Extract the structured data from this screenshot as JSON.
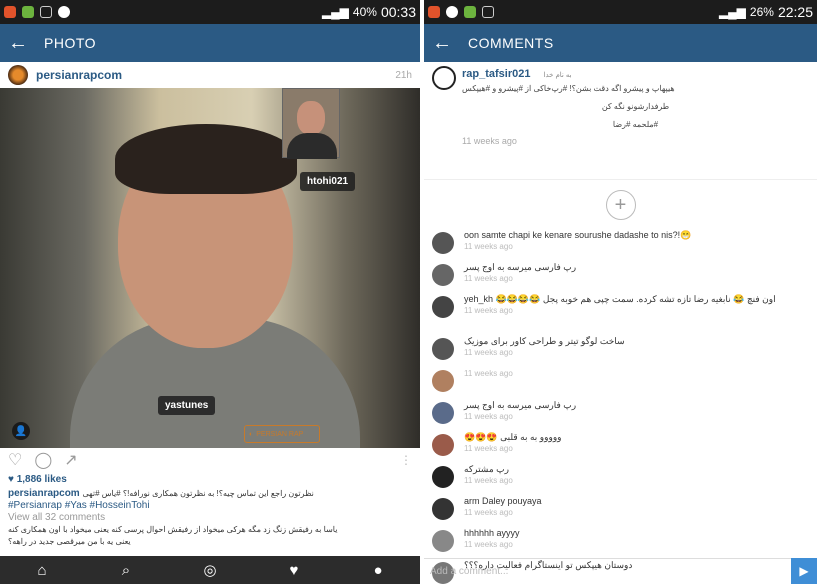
{
  "left": {
    "status": {
      "battery": "40%",
      "time": "00:33"
    },
    "appbar": {
      "title": "PHOTO"
    },
    "post": {
      "username": "persianrapcom",
      "time_ago": "21h",
      "tag_1": "htohi021",
      "tag_2": "yastunes",
      "logo_text": "PERSIAN RAP",
      "likes": "1,886 likes",
      "caption_user": "persianrapcom",
      "caption_text": "نظرتون راجع این تماس چیه؟! به نظرتون همکاری نورافه!؟ #یاس #تهی",
      "hashtags": "#Persianrap #Yas #HosseinTohi",
      "view_all": "View all 32 comments",
      "comment_1": "یاسا به رفیقش زنگ زد مگه هرکی میخواد از رفیقش احوال پرسی کنه یعنی میخواد با اون همکاری کنه",
      "comment_2": "یعنی یه با من میرقصی جدید در راهه؟"
    },
    "nav": [
      "⌂",
      "⌕",
      "◎",
      "♥",
      "●"
    ]
  },
  "right": {
    "status": {
      "battery": "26%",
      "time": "22:25"
    },
    "appbar": {
      "title": "COMMENTS"
    },
    "post": {
      "username": "rap_tafsir021",
      "subtitle": "به نام خدا",
      "line_1": "هیپهاپ و پیشرو اگه دقت بشن؟! #رپ‌خاکی از #پیشرو و #هیپکس",
      "line_2": "طرفدارشونو نگه کن",
      "line_3": "#ملحمه #رضا",
      "time_ago": "11 weeks ago"
    },
    "comments": [
      {
        "name": "",
        "text": "oon samte chapi ke kenare sourushe dadashe to nis?!😁",
        "ago": "11 weeks ago"
      },
      {
        "name": "",
        "text": "رپ فارسی میرسه به اوج پسر",
        "ago": "11 weeks ago"
      },
      {
        "name": "",
        "text": "yeh_kh 😂😂😂😂 اون فنچ 😂 نابغیه رضا تازه تشه کرده. سمت چپی هم خوبه پجل",
        "ago": "11 weeks ago"
      },
      {
        "name": "",
        "text": "ساخت لوگو تیتر و طراحی کاور برای موزیک",
        "ago": "11 weeks ago"
      },
      {
        "name": "",
        "text": "",
        "ago": "11 weeks ago"
      },
      {
        "name": "",
        "text": "رپ فارسی میرسه به اوج پسر",
        "ago": "11 weeks ago"
      },
      {
        "name": "",
        "text": "😍😍😍 ووووو به به قلبی",
        "ago": "11 weeks ago"
      },
      {
        "name": "",
        "text": "رپ مشترکه",
        "ago": "11 weeks ago"
      },
      {
        "name": "",
        "text": "arm Daley pouyaya",
        "ago": "11 weeks ago"
      },
      {
        "name": "",
        "text": "hhhhhh ayyyy",
        "ago": "11 weeks ago"
      },
      {
        "name": "",
        "text": "دوستان هیپکس تو اینستاگرام فعالیت داره؟؟؟",
        "ago": ""
      }
    ],
    "add_comment_placeholder": "Add a comment...",
    "send_icon": "▶"
  }
}
